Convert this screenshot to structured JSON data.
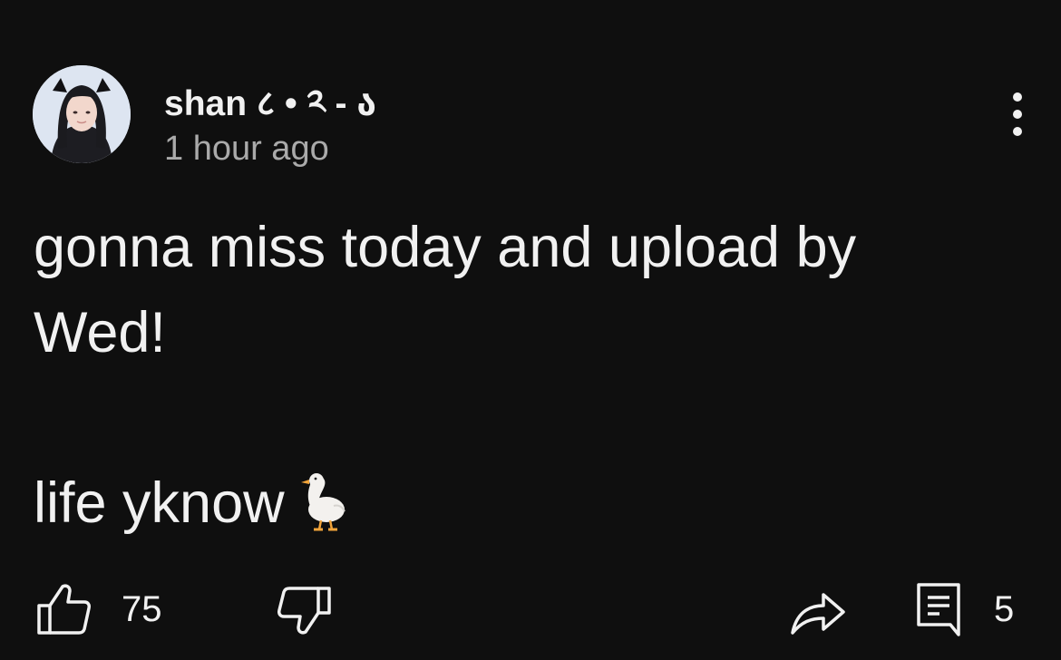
{
  "post": {
    "author": "shan ८ • ༢ - ა",
    "timestamp": "1 hour ago",
    "body_line1": "gonna miss today and upload by",
    "body_line2": "Wed!",
    "body_line3": "life yknow"
  },
  "actions": {
    "like_count": "75",
    "comment_count": "5"
  },
  "icons": {
    "avatar": "avatar-photo",
    "more": "more-vertical-icon",
    "like": "thumbs-up-icon",
    "dislike": "thumbs-down-icon",
    "share": "share-arrow-icon",
    "comments": "comment-icon",
    "emoji": "duck-emoji"
  },
  "colors": {
    "background": "#0f0f0f",
    "text": "#f1f1f1",
    "secondary_text": "#aaaaaa"
  }
}
